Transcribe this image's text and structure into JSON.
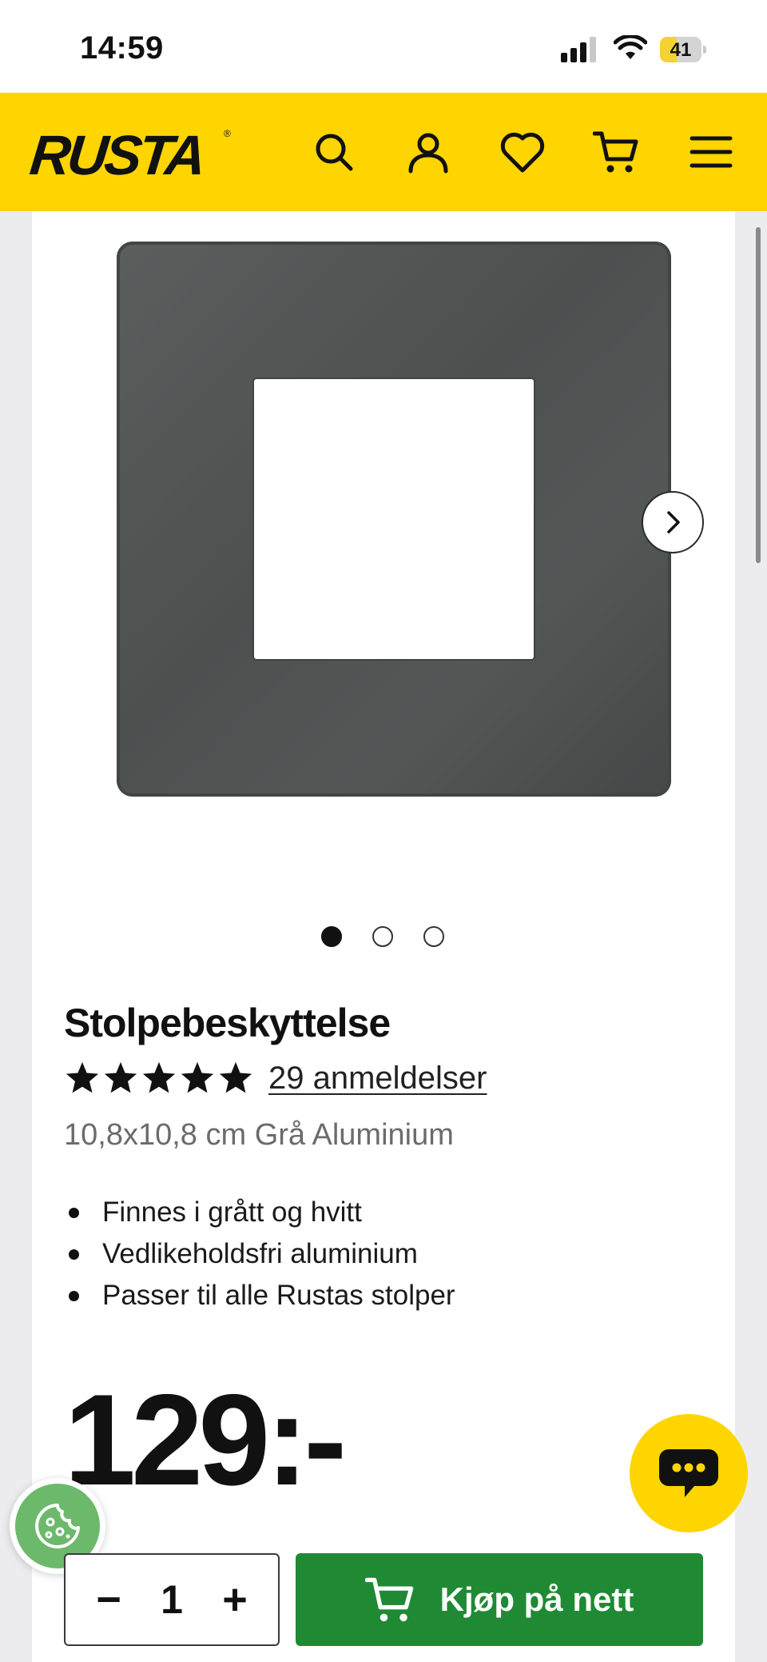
{
  "status_bar": {
    "time": "14:59",
    "battery": "41",
    "battery_level": 0.41
  },
  "header": {
    "logo": "RUSTA",
    "logo_mark": "®",
    "icons": [
      "search-icon",
      "account-icon",
      "heart-icon",
      "cart-icon",
      "menu-icon"
    ],
    "background_color": "#ffd500"
  },
  "product": {
    "title": "Stolpebeskyttelse",
    "rating_stars": 5,
    "reviews_link": "29 anmeldelser",
    "variant": "10,8x10,8 cm Grå Aluminium",
    "features": [
      "Finnes i grått og hvitt",
      "Vedlikeholdsfri aluminium",
      "Passer til alle Rustas stolper"
    ],
    "price": "129:-",
    "image_color": "#4f5352"
  },
  "gallery": {
    "total_images": 3,
    "active_index": 0
  },
  "purchase": {
    "quantity": "1",
    "decrement_label": "−",
    "increment_label": "+",
    "buy_label": "Kjøp på nett",
    "buy_color": "#1f8a33"
  },
  "floating": {
    "chat_icon": "chat-icon",
    "cookie_icon": "cookie-icon"
  }
}
